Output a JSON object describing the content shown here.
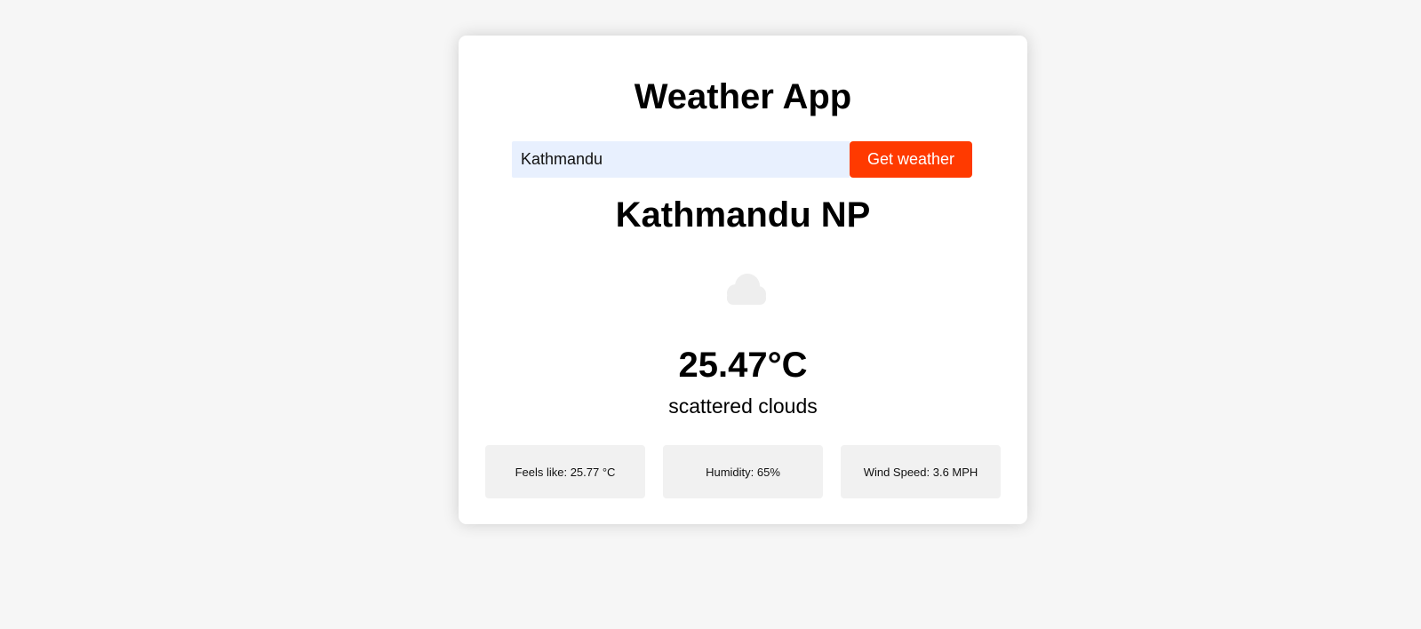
{
  "app": {
    "title": "Weather App"
  },
  "search": {
    "value": "Kathmandu",
    "button_label": "Get weather"
  },
  "weather": {
    "location": "Kathmandu NP",
    "icon": "cloud-icon",
    "temperature": "25.47°C",
    "description": "scattered clouds"
  },
  "details": [
    {
      "label": "Feels like: 25.77 °C"
    },
    {
      "label": "Humidity: 65%"
    },
    {
      "label": "Wind Speed: 3.6 MPH"
    }
  ],
  "colors": {
    "background": "#f6f6f6",
    "card": "#ffffff",
    "accent": "#ff3a00",
    "input_bg": "#e8f0fe",
    "detail_bg": "#f1f1f1"
  }
}
